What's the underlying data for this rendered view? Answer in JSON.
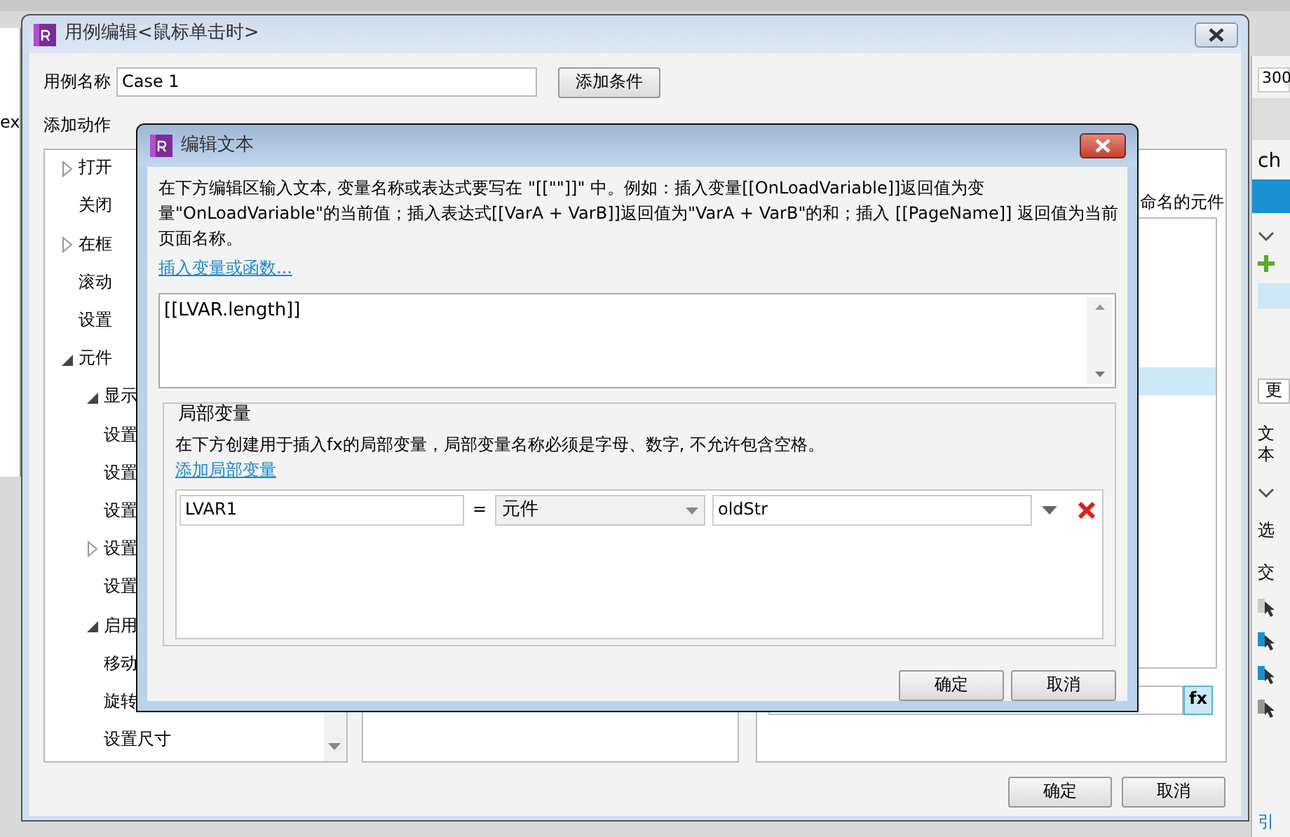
{
  "background": {
    "left_edge_text": "ex",
    "right_panel": {
      "size_value": "300",
      "title": "ch",
      "more_button": "更",
      "text_label": "文本",
      "select_label": "选",
      "interaction_label": "交",
      "link": "引"
    }
  },
  "case_editor": {
    "title": "用例编辑<鼠标单击时>",
    "case_name_label": "用例名称",
    "case_name": "Case 1",
    "add_condition_button": "添加条件",
    "add_action_label": "添加动作",
    "action_tree": [
      {
        "children": [
          {
            "label": "打开",
            "expanded": false
          },
          {
            "label": "关闭"
          },
          {
            "label": "在框",
            "expanded": false
          },
          {
            "label": "滚动"
          },
          {
            "label": "设置"
          }
        ]
      },
      {
        "label": "元件",
        "expanded": true,
        "children": [
          {
            "label": "显示",
            "expanded": true
          },
          {
            "label": "设置"
          },
          {
            "label": "设置"
          },
          {
            "label": "设置"
          },
          {
            "label": "设置",
            "expanded": false
          },
          {
            "label": "设置"
          },
          {
            "label": "启用",
            "expanded": true
          },
          {
            "label": "移动"
          },
          {
            "label": "旋转"
          },
          {
            "label": "设置尺寸"
          }
        ]
      }
    ],
    "configure": {
      "target_text": "命名的元件",
      "fx_button": "fx"
    },
    "buttons": [
      "确定",
      "取消"
    ]
  },
  "edit_text_dialog": {
    "title": "编辑文本",
    "description": "在下方编辑区输入文本, 变量名称或表达式要写在 \"[[\"\"]]\" 中。例如：插入变量[[OnLoadVariable]]返回值为变量\"OnLoadVariable\"的当前值；插入表达式[[VarA + VarB]]返回值为\"VarA + VarB\"的和；插入 [[PageName]] 返回值为当前页面名称。",
    "insert_link": "插入变量或函数...",
    "text_value": "[[LVAR.length]]",
    "local_variables": {
      "legend": "局部变量",
      "description": "在下方创建用于插入fx的局部变量，局部变量名称必须是字母、数字, 不允许包含空格。",
      "add_link": "添加局部变量",
      "rows": [
        {
          "name": "LVAR1",
          "operator": "=",
          "type": "元件",
          "target": "oldStr"
        }
      ]
    },
    "buttons": [
      "确定",
      "取消"
    ]
  }
}
